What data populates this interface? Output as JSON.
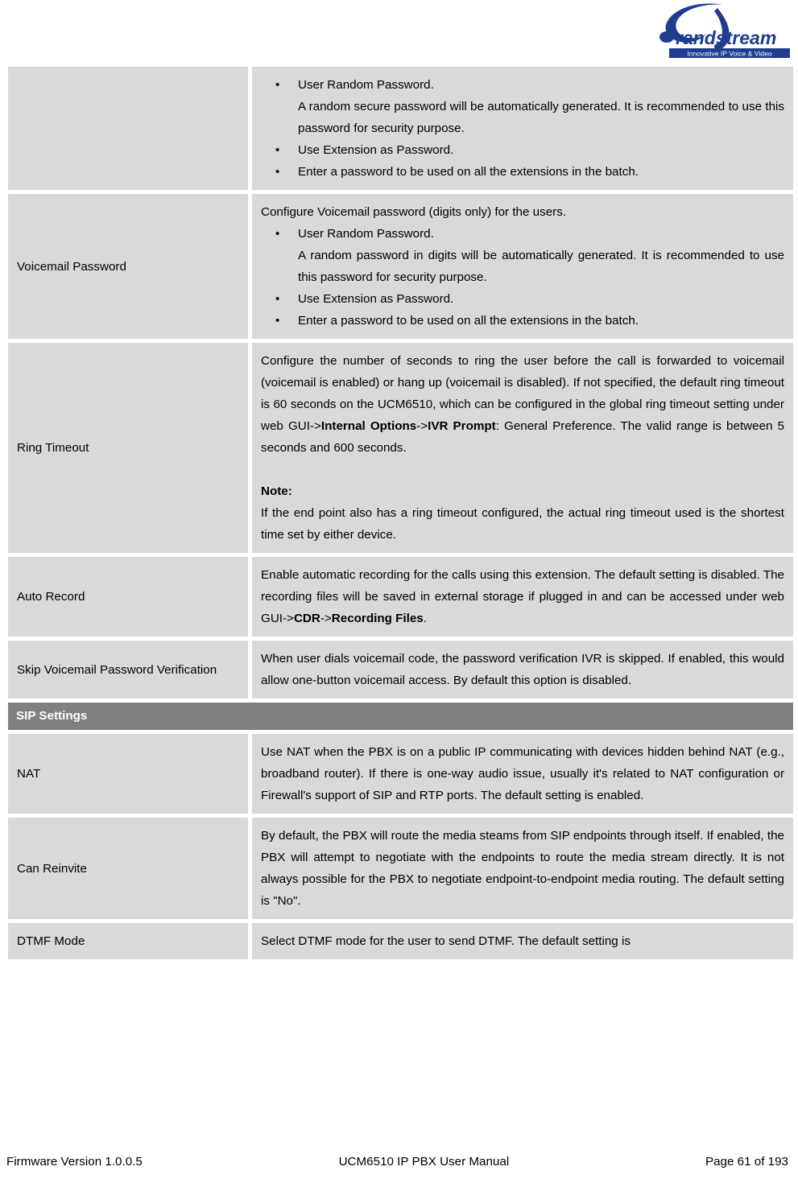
{
  "header": {
    "logo_name": "Grandstream",
    "logo_wordmark": "randstream",
    "logo_tagline": "Innovative IP Voice & Video"
  },
  "table": {
    "rows": [
      {
        "type": "setting",
        "label": "",
        "lead": "",
        "bullets": [
          {
            "text": "User Random Password.",
            "sub": "A random secure password will be automatically generated. It is recommended to use this password for security purpose."
          },
          {
            "text": "Use Extension as Password.",
            "sub": ""
          },
          {
            "text": "Enter a password to be used on all the extensions in the batch.",
            "sub": ""
          }
        ]
      },
      {
        "type": "setting",
        "label": "Voicemail Password",
        "lead": "Configure Voicemail password (digits only) for the users.",
        "bullets": [
          {
            "text": "User Random Password.",
            "sub": "A random password in digits will be automatically generated. It is recommended to use this password for security purpose."
          },
          {
            "text": "Use Extension as Password.",
            "sub": ""
          },
          {
            "text": "Enter a password to be used on all the extensions in the batch.",
            "sub": ""
          }
        ]
      },
      {
        "type": "setting",
        "label": "Ring Timeout",
        "paragraphs": [
          "Configure the number of seconds to ring the user before the call is forwarded to voicemail (voicemail is enabled) or hang up (voicemail is disabled). If not specified, the default ring timeout is 60 seconds on the UCM6510, which can be configured in the global ring timeout setting under web GUI->||Internal Options||->||IVR Prompt||: General Preference. The valid range is between 5 seconds and 600 seconds.",
          "",
          "||Note:||",
          "If the end point also has a ring timeout configured, the actual ring timeout used is the shortest time set by either device."
        ]
      },
      {
        "type": "setting",
        "label": "Auto Record",
        "paragraphs": [
          "Enable automatic recording for the calls using this extension. The default setting is disabled. The recording files will be saved in external storage if plugged in and can be accessed under web GUI->||CDR||->||Recording Files||."
        ]
      },
      {
        "type": "setting",
        "label": "Skip Voicemail Password Verification",
        "paragraphs": [
          "When user dials voicemail code, the password verification IVR is skipped. If enabled, this would allow one-button voicemail access. By default this option is disabled."
        ]
      },
      {
        "type": "section",
        "label": "SIP Settings"
      },
      {
        "type": "setting",
        "label": "NAT",
        "paragraphs": [
          "Use NAT when the PBX is on a public IP communicating with devices hidden behind NAT (e.g., broadband router). If there is one-way audio issue, usually it's related to NAT configuration or Firewall's support of SIP and RTP ports. The default setting is enabled."
        ]
      },
      {
        "type": "setting",
        "label": "Can Reinvite",
        "paragraphs": [
          "By default, the PBX will route the media steams from SIP endpoints through itself. If enabled, the PBX will attempt to negotiate with the endpoints to route the media stream directly. It is not always possible for the PBX to negotiate endpoint-to-endpoint media routing. The default setting is \"No\"."
        ]
      },
      {
        "type": "setting",
        "label": "DTMF Mode",
        "paragraphs": [
          "Select DTMF mode for the user to send DTMF. The default setting is"
        ]
      }
    ]
  },
  "footer": {
    "left": "Firmware Version 1.0.0.5",
    "center": "UCM6510 IP PBX User Manual",
    "right": "Page 61 of 193"
  },
  "colors": {
    "cell_background": "#d9d9d9",
    "section_background": "#808080",
    "section_text": "#ffffff",
    "page_background": "#ffffff",
    "logo_blue": "#1f3d8f"
  }
}
